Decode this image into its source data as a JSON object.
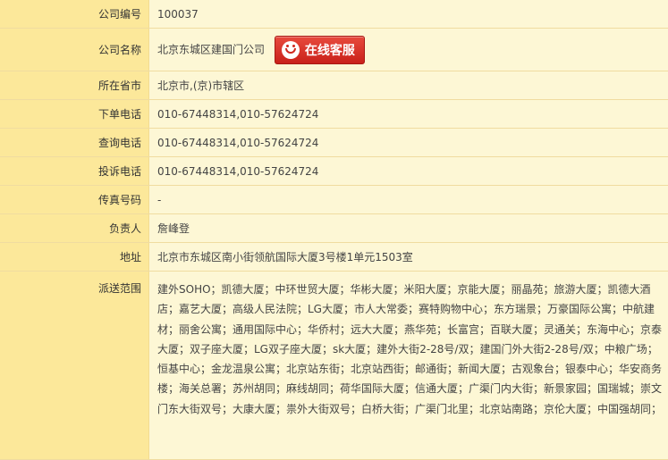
{
  "rows": {
    "company_id": {
      "label": "公司编号",
      "value": "100037"
    },
    "company_name": {
      "label": "公司名称",
      "value": "北京东城区建国门公司",
      "service_button": "在线客服"
    },
    "location": {
      "label": "所在省市",
      "value": "北京市,(京)市辖区"
    },
    "order_phone": {
      "label": "下单电话",
      "value": "010-67448314,010-57624724"
    },
    "inquiry_phone": {
      "label": "查询电话",
      "value": "010-67448314,010-57624724"
    },
    "complaint_phone": {
      "label": "投诉电话",
      "value": "010-67448314,010-57624724"
    },
    "fax": {
      "label": "传真号码",
      "value": "-"
    },
    "manager": {
      "label": "负责人",
      "value": "詹峰登"
    },
    "address": {
      "label": "地址",
      "value": "北京市东城区南小街领航国际大厦3号楼1单元1503室"
    },
    "delivery_area": {
      "label": "派送范围",
      "value": "建外SOHO；凯德大厦；中环世贸大厦；华彬大厦；米阳大厦；京能大厦；丽晶苑；旅游大厦；凯德大酒店；嘉艺大厦；高级人民法院；LG大厦；市人大常委；赛特购物中心；东方瑞景；万豪国际公寓；中航建材；丽舍公寓；通用国际中心；华侨村；远大大厦；燕华苑；长富宫；百联大厦；灵通关；东海中心；京泰大厦；双子座大厦；LG双子座大厦；sk大厦；建外大街2-28号/双；建国门外大街2-28号/双；中粮广场；恒基中心；金龙温泉公寓；北京站东街；北京站西街；邮通街；新闻大厦；古观象台；银泰中心；华安商务楼；海关总署；苏州胡同；麻线胡同；荷华国际大厦；信通大厦；广渠门内大街；新景家园；国瑞城；崇文门东大街双号；大康大厦；祟外大街双号；白桥大街；广渠门北里；北京站南路；京伦大厦；中国强胡同；"
    }
  },
  "colors": {
    "label_bg": "#fce89a",
    "value_bg": "#fdf7d5",
    "button_red": "#d0281e"
  }
}
